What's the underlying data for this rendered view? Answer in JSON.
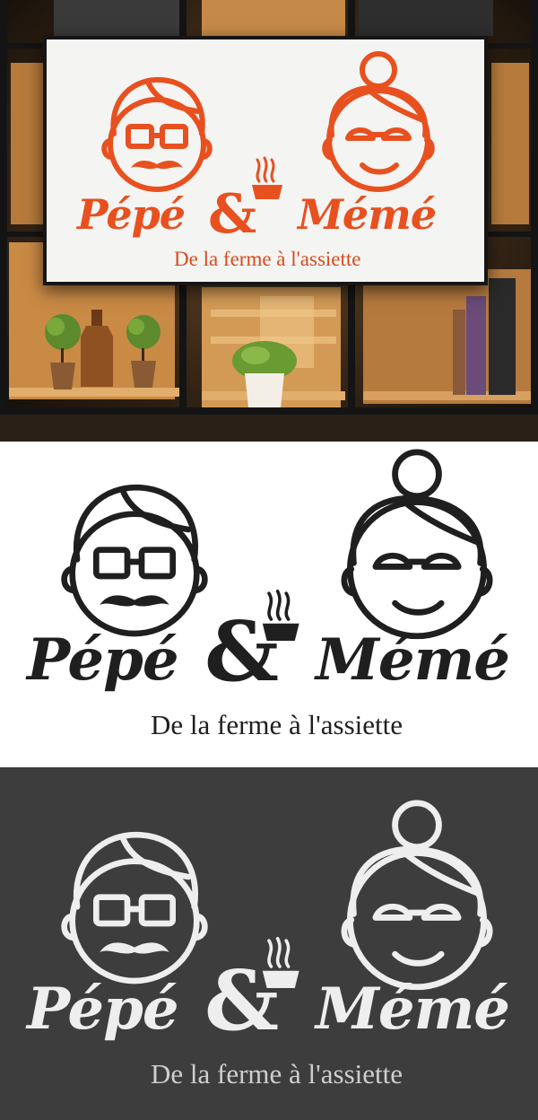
{
  "brand": {
    "left_name": "Pépé",
    "ampersand": "&",
    "right_name": "Mémé",
    "tagline": "De la ferme à l'assiette"
  },
  "icons": [
    "grandpa-face-icon",
    "grandma-face-icon",
    "steaming-cup-icon",
    "potted-plant-icon",
    "bottle-icon"
  ],
  "variants": [
    {
      "name": "photo-mockup",
      "logo_color": "#e8501f",
      "background": "#f4f4f2"
    },
    {
      "name": "black-on-white",
      "logo_color": "#1f1f1f",
      "background": "#ffffff"
    },
    {
      "name": "white-on-dark",
      "logo_color": "#eeeeee",
      "background": "#3d3d3d"
    }
  ]
}
